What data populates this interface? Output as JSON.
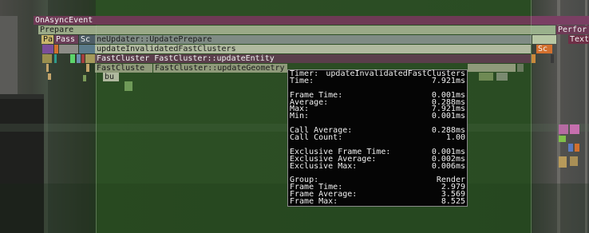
{
  "tracks": {
    "row0": {
      "main": "OnAsyncEvent",
      "right": ""
    },
    "row1": {
      "main": "Prepare",
      "right": "Perfor"
    },
    "row2": {
      "pa": "Pa",
      "pass": "Pass",
      "sc": "Sc",
      "updater": "neUpdater::UpdatePrepare",
      "right": "Text"
    },
    "row3": {
      "label": "updateInvalidatedFastClusters",
      "right_sc": "Sc"
    },
    "row4": {
      "label": "FastCluster  FastCluster::updateEntity"
    },
    "row5": {
      "label_a": "FastCluste",
      "label_b": "FastCluster::updateGeometry"
    },
    "row6": {
      "label": "bu"
    }
  },
  "tooltip": {
    "timer_label": "Timer:",
    "timer_value": "updateInvalidatedFastClusters",
    "time_label": "Time:",
    "time_value": "7.921ms",
    "frame_time_label": "Frame Time:",
    "frame_time_value": "0.001ms",
    "average_label": "Average:",
    "average_value": "0.288ms",
    "max_label": "Max:",
    "max_value": "7.921ms",
    "min_label": "Min:",
    "min_value": "0.001ms",
    "call_average_label": "Call Average:",
    "call_average_value": "0.288ms",
    "call_count_label": "Call Count:",
    "call_count_value": "1.00",
    "excl_frame_time_label": "Exclusive Frame Time:",
    "excl_frame_time_value": "0.001ms",
    "excl_average_label": "Exclusive Average:",
    "excl_average_value": "0.002ms",
    "excl_max_label": "Exclusive Max:",
    "excl_max_value": "0.006ms",
    "group_label": "Group:",
    "group_value": "Render",
    "g_frame_time_label": "Frame Time:",
    "g_frame_time_value": "2.979",
    "g_frame_average_label": "Frame Average:",
    "g_frame_average_value": "3.569",
    "g_frame_max_label": "Frame Max:",
    "g_frame_max_value": "8.525"
  },
  "colors": {
    "async_event": "#6e3a55",
    "prepare": "#9aa987",
    "update_prepare": "#7f8b84",
    "invalidated": "#b0b99f",
    "update_entity": "#5a3e4b",
    "update_geometry": "#8f9a7a",
    "tooltip_bg": "#050505"
  }
}
